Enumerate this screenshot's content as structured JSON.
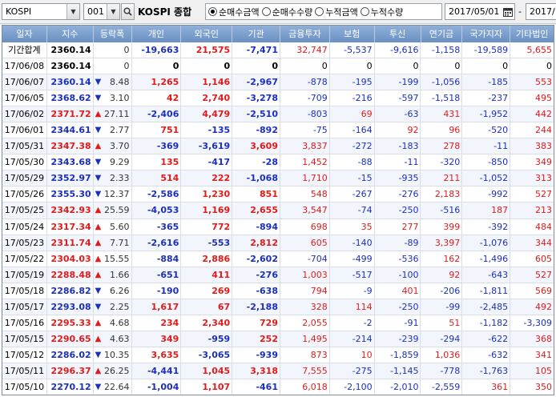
{
  "toolbar": {
    "market_value": "KOSPI",
    "code_value": "001",
    "index_name": "KOSPI 종합",
    "radios": [
      {
        "label": "순매수금액",
        "selected": true
      },
      {
        "label": "순매수수량",
        "selected": false
      },
      {
        "label": "누적금액",
        "selected": false
      },
      {
        "label": "누적수량",
        "selected": false
      }
    ],
    "date_from": "2017/05/01",
    "date_sep": "-",
    "date_to": "2017/"
  },
  "columns": [
    "일자",
    "지수",
    "등락폭",
    "개인",
    "외국인",
    "기관",
    "금융투자",
    "보험",
    "투신",
    "연기금",
    "국가지자",
    "기타법인"
  ],
  "rows": [
    {
      "date": "기간합계",
      "idx": "2360.14",
      "dir": "",
      "chg": "0",
      "v": [
        "-19,663",
        "21,575",
        "-7,471",
        "32,747",
        "-5,537",
        "-9,616",
        "-1,158",
        "-19,589",
        "5,655"
      ]
    },
    {
      "date": "17/06/08",
      "idx": "2360.14",
      "dir": "",
      "chg": "0",
      "v": [
        "0",
        "0",
        "0",
        "0",
        "0",
        "0",
        "0",
        "0",
        "0"
      ]
    },
    {
      "date": "17/06/07",
      "idx": "2360.14",
      "dir": "down",
      "chg": "8.48",
      "v": [
        "1,265",
        "1,146",
        "-2,967",
        "-878",
        "-195",
        "-199",
        "-1,056",
        "-185",
        "553"
      ]
    },
    {
      "date": "17/06/05",
      "idx": "2368.62",
      "dir": "down",
      "chg": "3.10",
      "v": [
        "42",
        "2,740",
        "-3,278",
        "-709",
        "-216",
        "-597",
        "-1,518",
        "-237",
        "495"
      ]
    },
    {
      "date": "17/06/02",
      "idx": "2371.72",
      "dir": "up",
      "chg": "27.11",
      "v": [
        "-2,406",
        "4,479",
        "-2,510",
        "-803",
        "69",
        "-63",
        "431",
        "-1,952",
        "442"
      ]
    },
    {
      "date": "17/06/01",
      "idx": "2344.61",
      "dir": "down",
      "chg": "2.77",
      "v": [
        "751",
        "-135",
        "-892",
        "-75",
        "-164",
        "92",
        "96",
        "-520",
        "244"
      ]
    },
    {
      "date": "17/05/31",
      "idx": "2347.38",
      "dir": "up",
      "chg": "3.70",
      "v": [
        "-369",
        "-3,619",
        "3,609",
        "3,837",
        "-272",
        "-183",
        "278",
        "-11",
        "383"
      ]
    },
    {
      "date": "17/05/30",
      "idx": "2343.68",
      "dir": "down",
      "chg": "9.29",
      "v": [
        "135",
        "-417",
        "-28",
        "1,452",
        "-88",
        "-11",
        "-320",
        "-850",
        "349"
      ]
    },
    {
      "date": "17/05/29",
      "idx": "2352.97",
      "dir": "down",
      "chg": "2.33",
      "v": [
        "514",
        "222",
        "-1,068",
        "1,710",
        "-15",
        "-935",
        "211",
        "-1,052",
        "313"
      ]
    },
    {
      "date": "17/05/26",
      "idx": "2355.30",
      "dir": "down",
      "chg": "12.37",
      "v": [
        "-2,586",
        "1,230",
        "851",
        "548",
        "-267",
        "-276",
        "2,183",
        "-992",
        "527"
      ]
    },
    {
      "date": "17/05/25",
      "idx": "2342.93",
      "dir": "up",
      "chg": "25.59",
      "v": [
        "-4,053",
        "1,169",
        "2,655",
        "3,547",
        "-74",
        "-250",
        "-516",
        "187",
        "213"
      ]
    },
    {
      "date": "17/05/24",
      "idx": "2317.34",
      "dir": "up",
      "chg": "5.60",
      "v": [
        "-365",
        "772",
        "-894",
        "698",
        "35",
        "277",
        "399",
        "-392",
        "484"
      ]
    },
    {
      "date": "17/05/23",
      "idx": "2311.74",
      "dir": "up",
      "chg": "7.71",
      "v": [
        "-2,616",
        "-553",
        "2,812",
        "605",
        "-140",
        "-89",
        "3,397",
        "-1,076",
        "344"
      ]
    },
    {
      "date": "17/05/22",
      "idx": "2304.03",
      "dir": "up",
      "chg": "15.55",
      "v": [
        "-884",
        "2,886",
        "-2,602",
        "-704",
        "-499",
        "-536",
        "162",
        "-1,496",
        "605"
      ]
    },
    {
      "date": "17/05/19",
      "idx": "2288.48",
      "dir": "up",
      "chg": "1.66",
      "v": [
        "-651",
        "411",
        "-276",
        "1,003",
        "-517",
        "-100",
        "92",
        "-643",
        "527"
      ]
    },
    {
      "date": "17/05/18",
      "idx": "2286.82",
      "dir": "down",
      "chg": "6.26",
      "v": [
        "-190",
        "269",
        "-638",
        "794",
        "-9",
        "401",
        "-206",
        "-1,811",
        "569"
      ]
    },
    {
      "date": "17/05/17",
      "idx": "2293.08",
      "dir": "down",
      "chg": "2.25",
      "v": [
        "1,617",
        "67",
        "-2,188",
        "328",
        "114",
        "-250",
        "-99",
        "-2,485",
        "492"
      ]
    },
    {
      "date": "17/05/16",
      "idx": "2295.33",
      "dir": "up",
      "chg": "4.68",
      "v": [
        "234",
        "2,340",
        "729",
        "2,055",
        "-2",
        "-91",
        "51",
        "-1,182",
        "-3,309"
      ]
    },
    {
      "date": "17/05/15",
      "idx": "2290.65",
      "dir": "up",
      "chg": "4.63",
      "v": [
        "349",
        "-959",
        "252",
        "1,495",
        "-214",
        "-239",
        "-294",
        "-622",
        "368"
      ]
    },
    {
      "date": "17/05/12",
      "idx": "2286.02",
      "dir": "down",
      "chg": "10.35",
      "v": [
        "3,635",
        "-3,065",
        "-939",
        "873",
        "10",
        "-1,859",
        "1,036",
        "-632",
        "341"
      ]
    },
    {
      "date": "17/05/11",
      "idx": "2296.37",
      "dir": "up",
      "chg": "26.25",
      "v": [
        "-4,441",
        "1,045",
        "3,318",
        "7,555",
        "-275",
        "-1,145",
        "-778",
        "-1,763",
        "105"
      ]
    },
    {
      "date": "17/05/10",
      "idx": "2270.12",
      "dir": "down",
      "chg": "22.64",
      "v": [
        "-1,004",
        "1,107",
        "-461",
        "6,018",
        "-2,100",
        "-2,010",
        "-2,559",
        "361",
        "350"
      ]
    }
  ],
  "colors": {
    "up": "#e31a1a",
    "down": "#1a2fc0",
    "header": "#7a9dcc"
  },
  "icons": {
    "up": "up-triangle-icon",
    "down": "down-triangle-icon"
  }
}
